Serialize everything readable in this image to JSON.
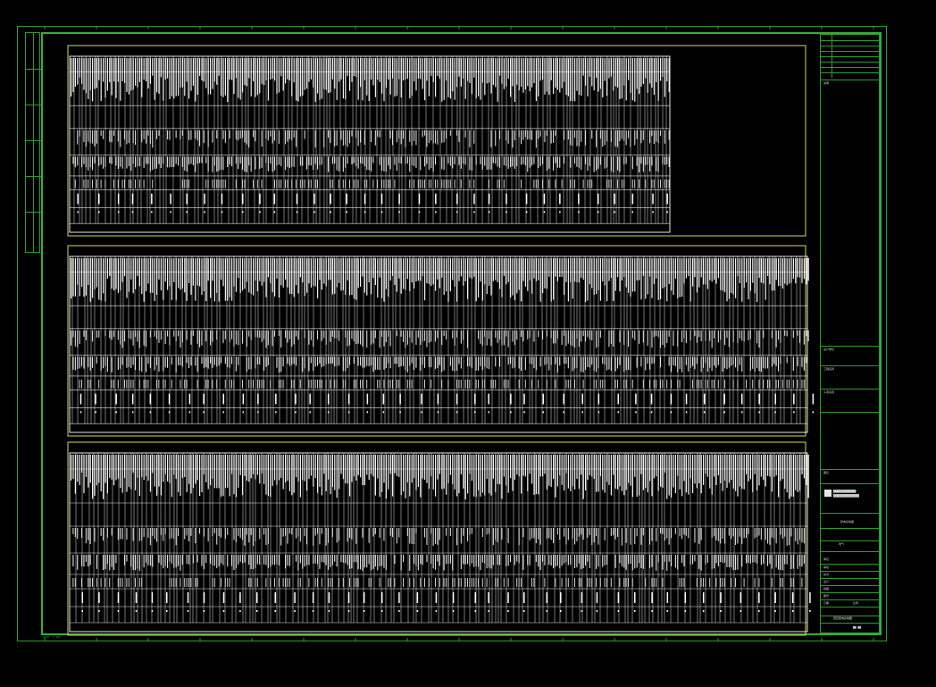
{
  "drawing": {
    "title_block_texts": [
      "图纸目录",
      "说明",
      "设计单位",
      "工程名称",
      "子项名称",
      "图名",
      "配电系统图",
      "审定",
      "审核",
      "校对",
      "设计",
      "制图",
      "图号",
      "日期",
      "比例",
      "专业",
      "电气"
    ],
    "bottom_label": "低压配电系统图",
    "footer_note": "NOTE: 1:100",
    "colors": {
      "outer_frame": "#2e9b2e",
      "inner_frame": "#35b035",
      "panel_border": "#d8d8d8",
      "panel_inner": "#d8d85a",
      "background": "#000000"
    }
  }
}
